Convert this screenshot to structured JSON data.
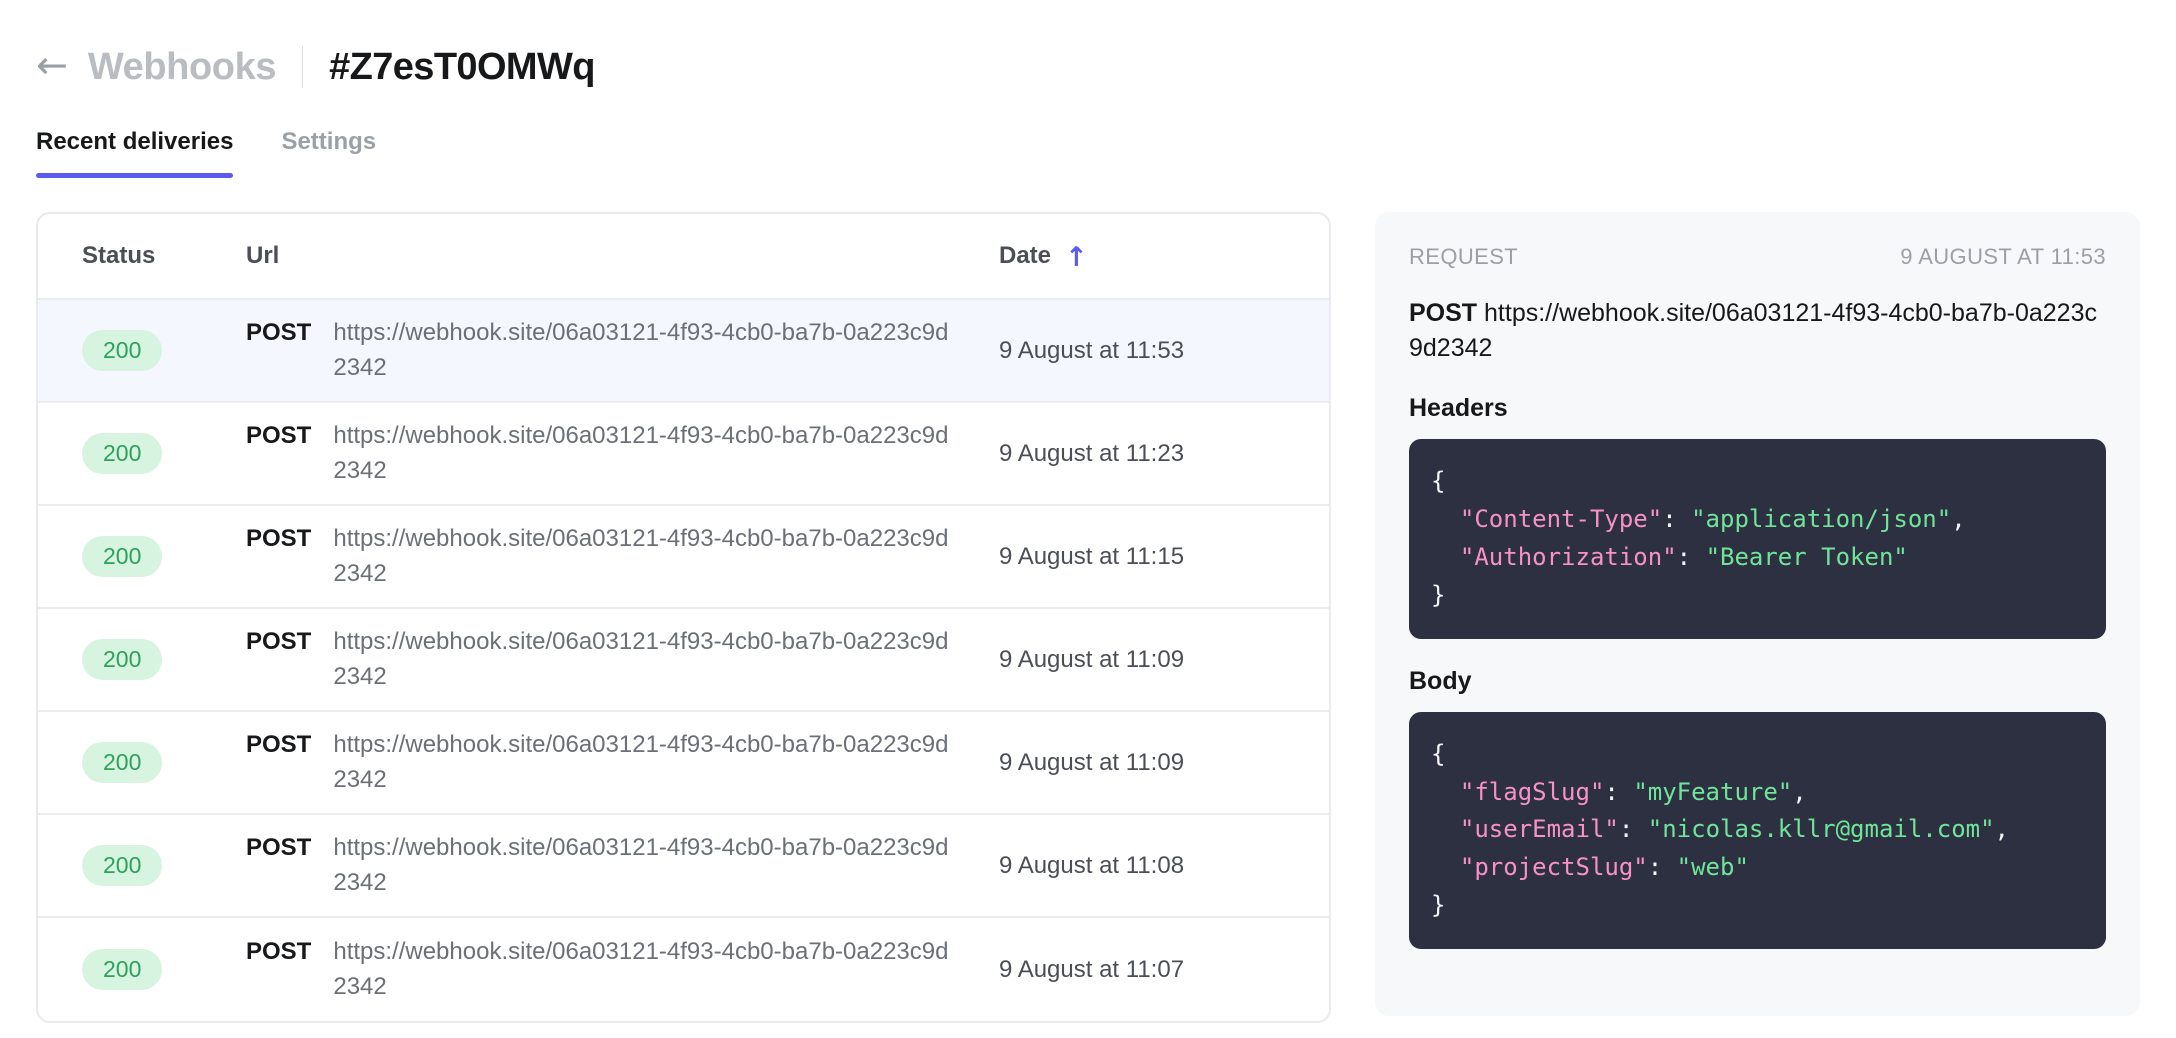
{
  "header": {
    "back_icon": "arrow-left-icon",
    "back_arrow_glyph": "←",
    "parent_label": "Webhooks",
    "title": "#Z7esT0OMWq"
  },
  "tabs": [
    {
      "label": "Recent deliveries",
      "active": true
    },
    {
      "label": "Settings",
      "active": false
    }
  ],
  "table": {
    "columns": {
      "status": "Status",
      "url": "Url",
      "date": "Date",
      "sort_icon": "arrow-up-icon",
      "sort_glyph": "↑",
      "sort_direction": "ascending"
    },
    "rows": [
      {
        "status": "200",
        "method": "POST",
        "url": "https://webhook.site/06a03121-4f93-4cb0-ba7b-0a223c9d2342",
        "date": "9 August at 11:53",
        "selected": true
      },
      {
        "status": "200",
        "method": "POST",
        "url": "https://webhook.site/06a03121-4f93-4cb0-ba7b-0a223c9d2342",
        "date": "9 August at 11:23",
        "selected": false
      },
      {
        "status": "200",
        "method": "POST",
        "url": "https://webhook.site/06a03121-4f93-4cb0-ba7b-0a223c9d2342",
        "date": "9 August at 11:15",
        "selected": false
      },
      {
        "status": "200",
        "method": "POST",
        "url": "https://webhook.site/06a03121-4f93-4cb0-ba7b-0a223c9d2342",
        "date": "9 August at 11:09",
        "selected": false
      },
      {
        "status": "200",
        "method": "POST",
        "url": "https://webhook.site/06a03121-4f93-4cb0-ba7b-0a223c9d2342",
        "date": "9 August at 11:09",
        "selected": false
      },
      {
        "status": "200",
        "method": "POST",
        "url": "https://webhook.site/06a03121-4f93-4cb0-ba7b-0a223c9d2342",
        "date": "9 August at 11:08",
        "selected": false
      },
      {
        "status": "200",
        "method": "POST",
        "url": "https://webhook.site/06a03121-4f93-4cb0-ba7b-0a223c9d2342",
        "date": "9 August at 11:07",
        "selected": false
      }
    ]
  },
  "detail": {
    "label": "REQUEST",
    "timestamp": "9 AUGUST AT 11:53",
    "method": "POST",
    "url": "https://webhook.site/06a03121-4f93-4cb0-ba7b-0a223c9d2342",
    "headers_title": "Headers",
    "headers_json": {
      "open": "{",
      "lines": [
        {
          "key": "\"Content-Type\"",
          "sep": ": ",
          "value": "\"application/json\"",
          "comma": ","
        },
        {
          "key": "\"Authorization\"",
          "sep": ": ",
          "value": "\"Bearer Token\"",
          "comma": ""
        }
      ],
      "close": "}"
    },
    "body_title": "Body",
    "body_json": {
      "open": "{",
      "lines": [
        {
          "key": "\"flagSlug\"",
          "sep": ": ",
          "value": "\"myFeature\"",
          "comma": ","
        },
        {
          "key": "\"userEmail\"",
          "sep": ": ",
          "value": "\"nicolas.kllr@gmail.com\"",
          "comma": ","
        },
        {
          "key": "\"projectSlug\"",
          "sep": ": ",
          "value": "\"web\"",
          "comma": ""
        }
      ],
      "close": "}"
    }
  },
  "colors": {
    "accent": "#5b5bf0",
    "status_ok_text": "#2fa15c",
    "status_ok_bg": "#d6f4e0",
    "code_bg": "#2c3040",
    "code_key": "#f692c8",
    "code_value": "#70e59a",
    "row_selected_bg": "#f4f7fd"
  }
}
